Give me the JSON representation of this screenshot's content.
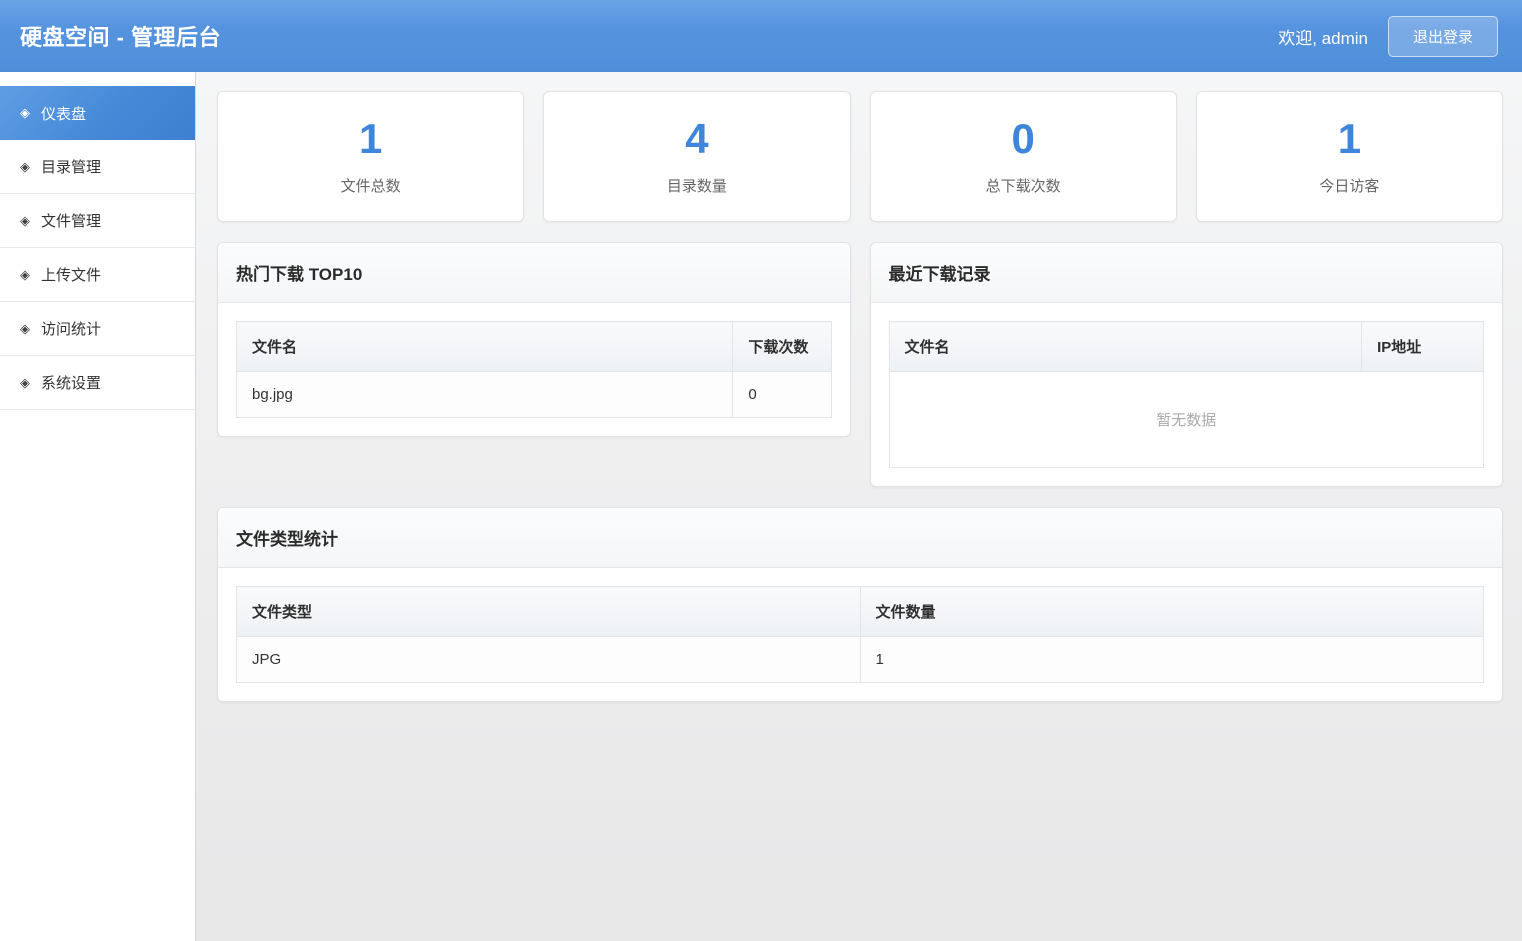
{
  "header": {
    "title": "硬盘空间 - 管理后台",
    "welcome": "欢迎, admin",
    "logout_label": "退出登录"
  },
  "sidebar": {
    "items": [
      {
        "icon": "◈",
        "label": "仪表盘",
        "active": true
      },
      {
        "icon": "◈",
        "label": "目录管理",
        "active": false
      },
      {
        "icon": "◈",
        "label": "文件管理",
        "active": false
      },
      {
        "icon": "◈",
        "label": "上传文件",
        "active": false
      },
      {
        "icon": "◈",
        "label": "访问统计",
        "active": false
      },
      {
        "icon": "◈",
        "label": "系统设置",
        "active": false
      }
    ]
  },
  "stats": {
    "cards": [
      {
        "value": "1",
        "label": "文件总数"
      },
      {
        "value": "4",
        "label": "目录数量"
      },
      {
        "value": "0",
        "label": "总下载次数"
      },
      {
        "value": "1",
        "label": "今日访客"
      }
    ]
  },
  "panels": {
    "hot_downloads": {
      "title": "热门下载 TOP10",
      "columns": [
        "文件名",
        "下载次数"
      ],
      "rows": [
        [
          "bg.jpg",
          "0"
        ]
      ]
    },
    "recent_downloads": {
      "title": "最近下载记录",
      "columns": [
        "文件名",
        "IP地址"
      ],
      "rows": [],
      "empty_text": "暂无数据"
    },
    "file_types": {
      "title": "文件类型统计",
      "columns": [
        "文件类型",
        "文件数量"
      ],
      "rows": [
        [
          "JPG",
          "1"
        ]
      ]
    }
  },
  "colors": {
    "header_blue": "#5593df",
    "accent_blue": "#3e86dc",
    "active_item_blue": "#4488d7",
    "empty_text_gray": "#aaaaaa"
  }
}
